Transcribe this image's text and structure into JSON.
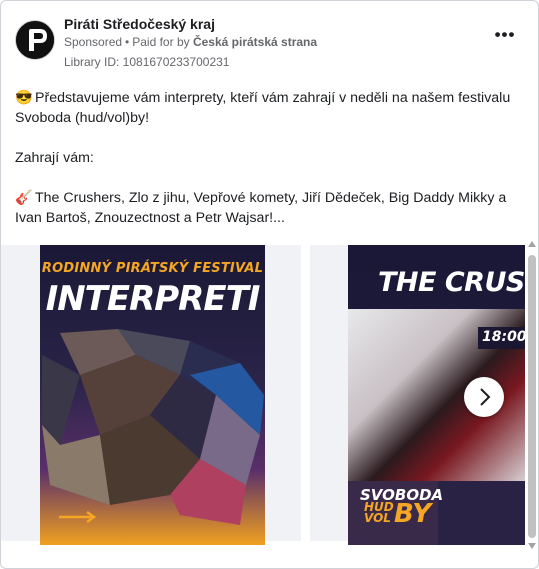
{
  "header": {
    "page_name": "Piráti Středočeský kraj",
    "sponsored": "Sponsored",
    "paid_for_prefix": "Paid for by",
    "payer": "Česká pirátská strana",
    "library_id": "Library ID: 1081670233700231",
    "more_label": "•••",
    "avatar_icon": "pirate-party-logo-icon",
    "more_icon": "more-options-icon"
  },
  "post": {
    "line1_emoji": "😎",
    "line1": "Představujeme vám interprety, kteří vám zahrají v neděli na našem festivalu Svoboda (hud/vol)by!",
    "line2": "Zahrají vám:",
    "line3_emoji": "🎸",
    "line3": "The Crushers, Zlo z jihu, Vepřové komety, Jiří Dědeček, Big Daddy Mikky a Ivan Bartoš, Znouzectnost a Petr Wajsar!..."
  },
  "carousel": {
    "poster1_subtitle": "RODINNÝ PIRÁTSKÝ FESTIVAL",
    "poster1_title": "INTERPRETI",
    "poster2_title": "THE CRUSHERS",
    "poster2_time": "18:00–",
    "logo_line1": "SVOBODA",
    "logo_line2": "HUD VOL",
    "logo_by": "BY",
    "next_icon": "chevron-right-icon"
  },
  "colors": {
    "accent_orange": "#f5a623",
    "poster_dark": "#1a1836",
    "meta_gray": "#65676b"
  }
}
